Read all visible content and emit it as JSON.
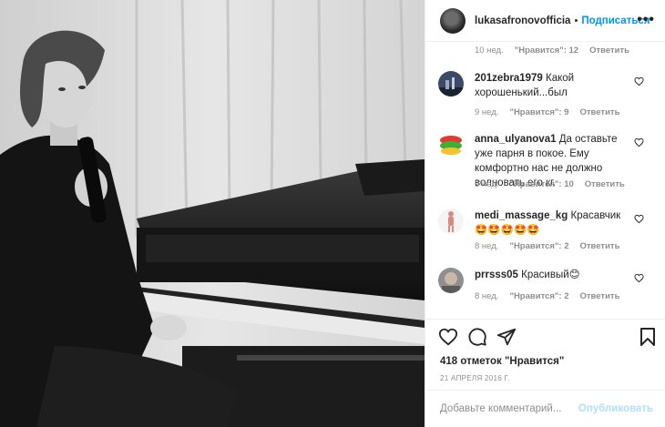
{
  "post": {
    "author": "lukasafronovofficia",
    "dot": "•",
    "follow_label": "Подписаться",
    "more_label": "•••"
  },
  "top_meta": {
    "time": "10 нед.",
    "likes": "\"Нравится\": 12",
    "reply": "Ответить"
  },
  "comments": [
    {
      "username": "201zebra1979",
      "text": "Какой хорошенький...был",
      "time": "9 нед.",
      "likes": "\"Нравится\": 9",
      "reply": "Ответить",
      "avatar_icon": "avatar-night-sky"
    },
    {
      "username": "anna_ulyanova1",
      "text": "Да оставьте уже парня в покое. Ему комфортно нас не должно волновать его кг.",
      "time": "9 нед.",
      "likes": "\"Нравится\": 10",
      "reply": "Ответить",
      "avatar_icon": "avatar-colorful"
    },
    {
      "username": "medi_massage_kg",
      "text": "Красавчик 🤩🤩🤩🤩🤩",
      "time": "8 нед.",
      "likes": "\"Нравится\": 2",
      "reply": "Ответить",
      "avatar_icon": "avatar-body-figure"
    },
    {
      "username": "prrsss05",
      "text": "Красивый😊",
      "time": "8 нед.",
      "likes": "\"Нравится\": 2",
      "reply": "Ответить",
      "avatar_icon": "avatar-person"
    }
  ],
  "actions": {
    "likes_count": "418 отметок \"Нравится\"",
    "date": "21 АПРЕЛЯ 2016 Г.",
    "add_comment_placeholder": "Добавьте комментарий...",
    "publish_label": "Опубликовать"
  },
  "colors": {
    "accent": "#0095f6",
    "publish_disabled": "#b2dffc",
    "muted": "#8e8e8e",
    "text": "#262626"
  }
}
